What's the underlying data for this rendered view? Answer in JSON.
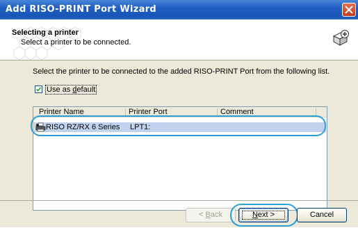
{
  "window": {
    "title": "Add RISO-PRINT Port Wizard"
  },
  "header": {
    "heading": "Selecting a printer",
    "subheading": "Select a printer to be connected."
  },
  "instruction": "Select the printer to be connected to the added RISO-PRINT Port from the following list.",
  "default_checkbox": {
    "label_pre": "Use as ",
    "label_key": "d",
    "label_post": "efault",
    "checked": true
  },
  "list": {
    "columns": [
      "Printer Name",
      "Printer Port",
      "Comment"
    ],
    "rows": [
      {
        "name": "RISO RZ/RX 6 Series",
        "port": "LPT1:",
        "comment": ""
      }
    ]
  },
  "buttons": {
    "back_key": "B",
    "back_rest": "ack",
    "back_prefix": "< ",
    "next_key": "N",
    "next_rest": "ext >",
    "cancel": "Cancel"
  },
  "colors": {
    "titlebar": "#1f5ec4",
    "highlight": "#2b9fd8",
    "selection": "#c1d2ee"
  }
}
